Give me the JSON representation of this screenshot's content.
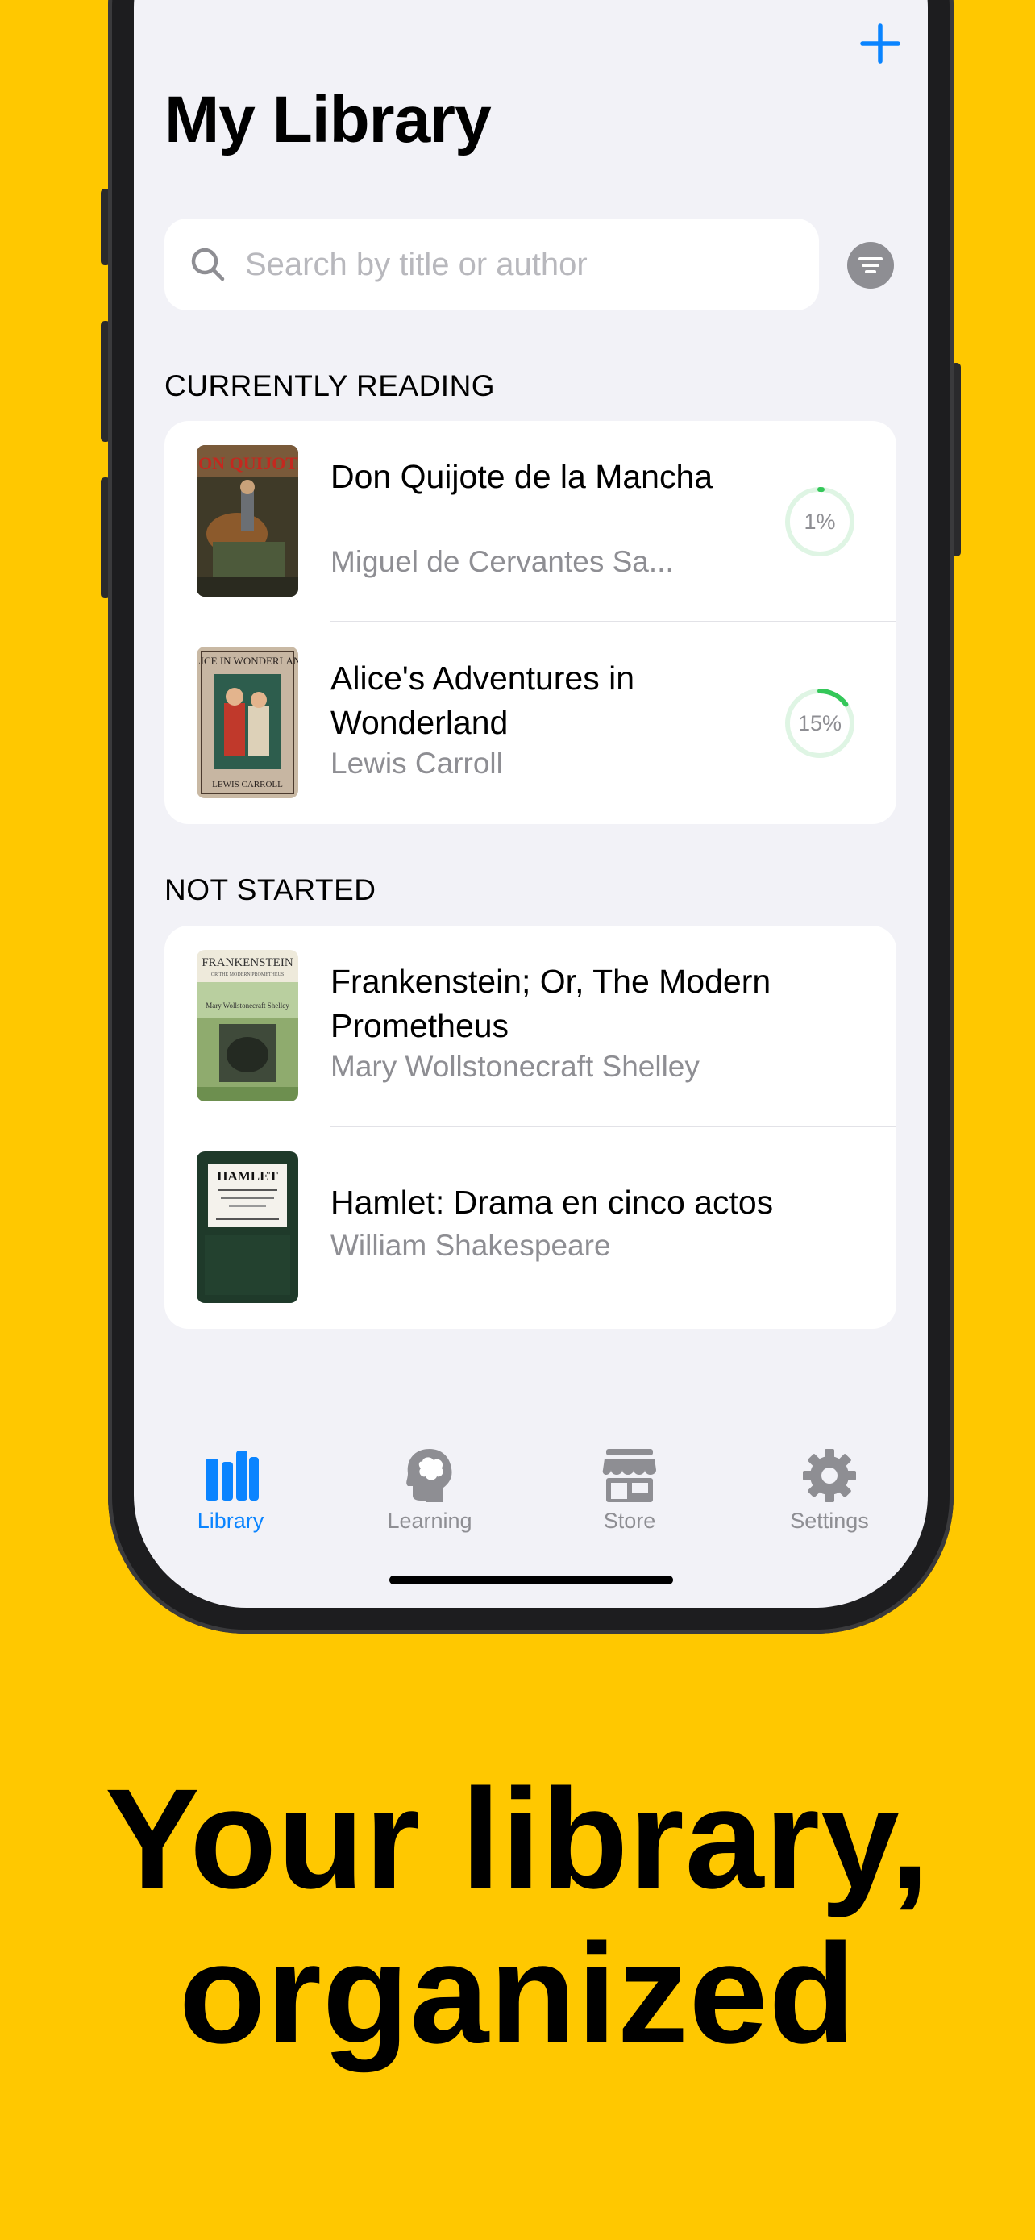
{
  "header": {
    "title": "My Library",
    "add_icon": "plus-icon"
  },
  "search": {
    "placeholder": "Search by title or author",
    "value": ""
  },
  "sections": {
    "currently_reading": {
      "title": "CURRENTLY READING",
      "books": [
        {
          "title": "Don Quijote de la Mancha",
          "author": "Miguel de Cervantes Sa...",
          "progress_label": "1%",
          "progress": 0.01
        },
        {
          "title": "Alice's Adventures in Wonderland",
          "author": "Lewis Carroll",
          "progress_label": "15%",
          "progress": 0.15
        }
      ]
    },
    "not_started": {
      "title": "NOT STARTED",
      "books": [
        {
          "title": "Frankenstein; Or, The Modern Prometheus",
          "author": "Mary Wollstonecraft Shelley"
        },
        {
          "title": "Hamlet: Drama en cinco actos",
          "author": "William Shakespeare"
        }
      ]
    }
  },
  "covers": {
    "quijote": "DON QUIJOTE",
    "alice": "ALICE IN WONDERLAND",
    "alice_author": "LEWIS CARROLL",
    "frankenstein": "FRANKENSTEIN",
    "frankenstein_sub": "OR THE MODERN PROMETHEUS",
    "frankenstein_author": "Mary Wollstonecraft Shelley",
    "hamlet": "HAMLET"
  },
  "tabbar": {
    "tabs": [
      {
        "label": "Library",
        "icon": "books-icon",
        "active": true
      },
      {
        "label": "Learning",
        "icon": "brain-head-icon",
        "active": false
      },
      {
        "label": "Store",
        "icon": "storefront-icon",
        "active": false
      },
      {
        "label": "Settings",
        "icon": "gear-icon",
        "active": false
      }
    ]
  },
  "colors": {
    "background": "#FFC800",
    "accent": "#0A84FF",
    "progress": "#34C759",
    "screen": "#F2F2F7"
  },
  "caption": {
    "line1": "Your library,",
    "line2": "organized"
  }
}
